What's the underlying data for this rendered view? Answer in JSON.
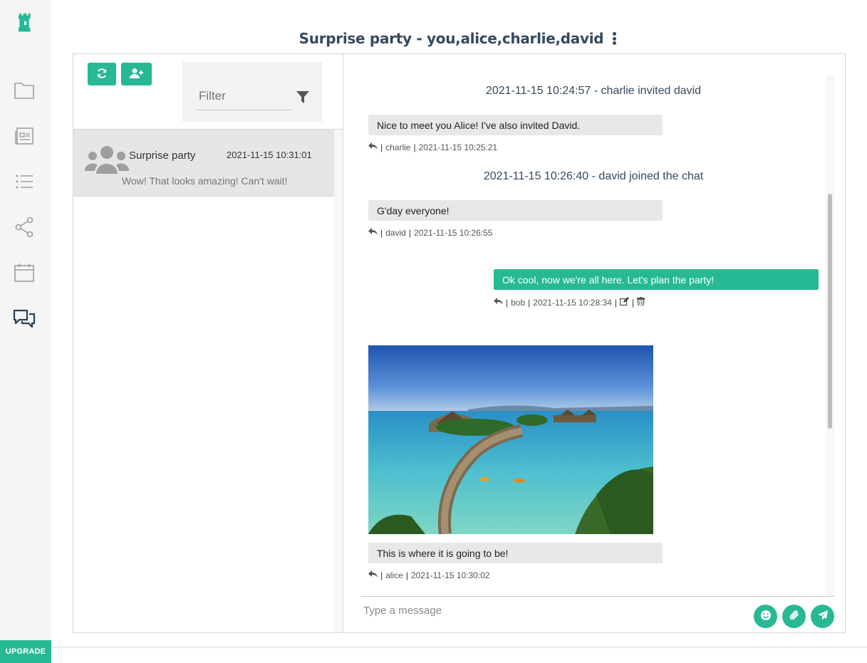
{
  "sidebar": {
    "logo": "tower-logo",
    "items": [
      {
        "name": "folder-icon"
      },
      {
        "name": "newspaper-icon"
      },
      {
        "name": "list-icon"
      },
      {
        "name": "share-icon"
      },
      {
        "name": "calendar-icon"
      },
      {
        "name": "chat-icon",
        "active": true
      }
    ],
    "upgrade_label": "UPGRADE"
  },
  "header": {
    "title": "Surprise party - you,alice,charlie,david"
  },
  "chat_list": {
    "filter_placeholder": "Filter",
    "items": [
      {
        "name": "Surprise party",
        "time": "2021-11-15 10:31:01",
        "preview": "Wow! That looks amazing! Can't wait!"
      }
    ]
  },
  "messages": {
    "event1": "2021-11-15 10:24:57 - charlie invited david",
    "m1": {
      "text": "Nice to meet you Alice! I've also invited David.",
      "author": "charlie",
      "time": "2021-11-15 10:25:21"
    },
    "event2": "2021-11-15 10:26:40 - david joined the chat",
    "m2": {
      "text": "G'day everyone!",
      "author": "david",
      "time": "2021-11-15 10:26:55"
    },
    "m3": {
      "text": "Ok cool, now we're all here. Let's plan the party!",
      "author": "bob",
      "time": "2021-11-15 10:28:34"
    },
    "m4": {
      "text": "This is where it is going to be!",
      "author": "alice",
      "time": "2021-11-15 10:30:02"
    },
    "separator": "|"
  },
  "composer": {
    "placeholder": "Type a message"
  },
  "colors": {
    "accent": "#27b994",
    "bubble": "#e8e8e8",
    "title": "#34495e"
  }
}
